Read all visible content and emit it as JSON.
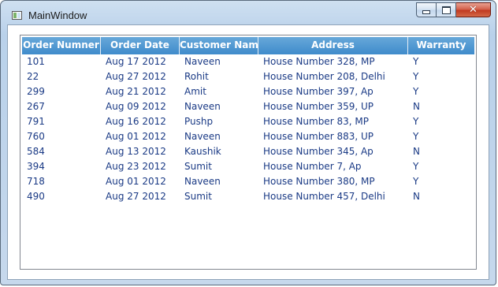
{
  "window": {
    "title": "MainWindow"
  },
  "grid": {
    "columns": [
      "Order Numner",
      "Order Date",
      "Customer Name",
      "Address",
      "Warranty"
    ],
    "rows": [
      [
        "101",
        "Aug 17 2012",
        "Naveen",
        "House Number  328, MP",
        "Y"
      ],
      [
        "22",
        "Aug 27 2012",
        "Rohit",
        "House Number  208, Delhi",
        "Y"
      ],
      [
        "299",
        "Aug 21 2012",
        "Amit",
        "House Number  397, Ap",
        "Y"
      ],
      [
        "267",
        "Aug 09 2012",
        "Naveen",
        "House Number  359, UP",
        "N"
      ],
      [
        "791",
        "Aug 16 2012",
        "Pushp",
        "House Number  83, MP",
        "Y"
      ],
      [
        "760",
        "Aug 01 2012",
        "Naveen",
        "House Number  883, UP",
        "Y"
      ],
      [
        "584",
        "Aug 13 2012",
        "Kaushik",
        "House Number  345, Ap",
        "N"
      ],
      [
        "394",
        "Aug 23 2012",
        "Sumit",
        "House Number  7, Ap",
        "Y"
      ],
      [
        "718",
        "Aug 01 2012",
        "Naveen",
        "House Number  380, MP",
        "Y"
      ],
      [
        "490",
        "Aug 27 2012",
        "Sumit",
        "House Number  457, Delhi",
        "N"
      ]
    ]
  },
  "colors": {
    "header": "#3f8bcb",
    "cell_text": "#1a3a85"
  }
}
